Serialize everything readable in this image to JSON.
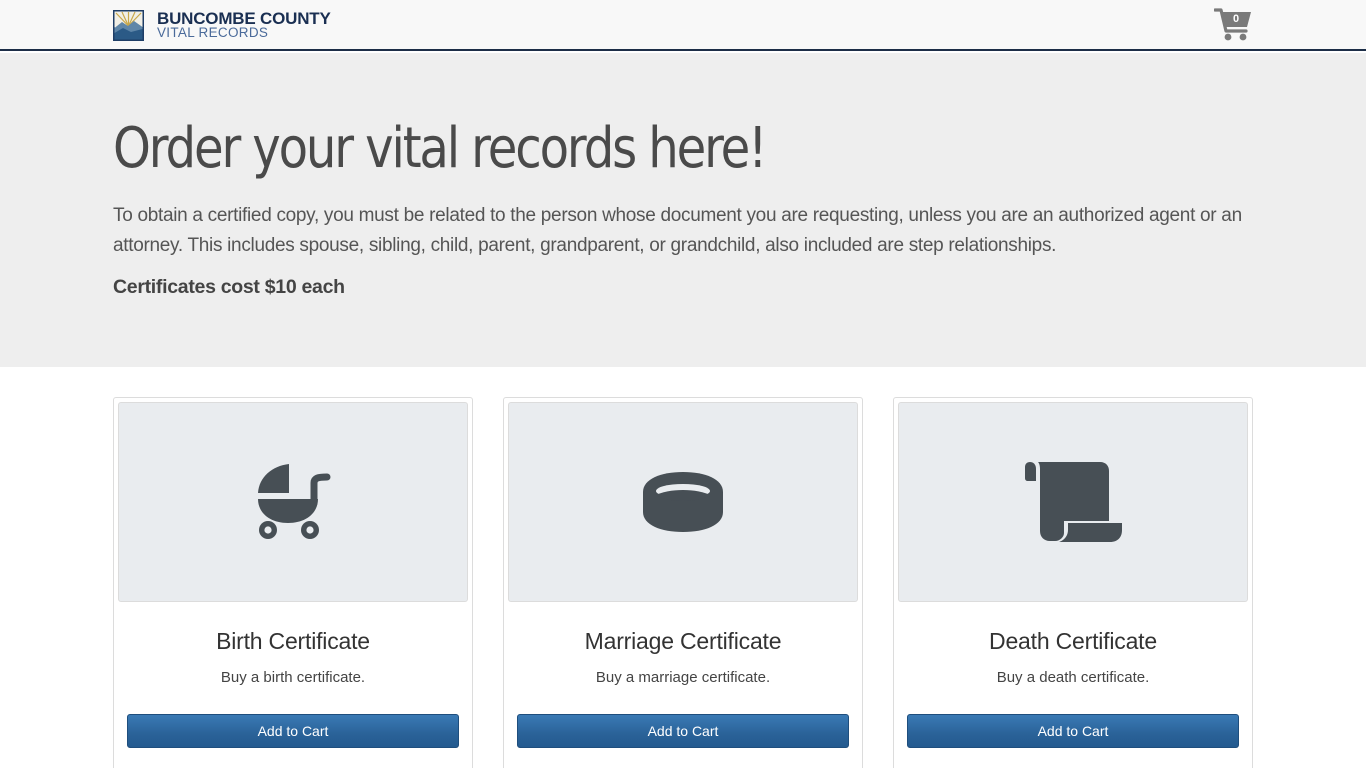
{
  "header": {
    "brand_line1": "BUNCOMBE COUNTY",
    "brand_line2": "VITAL RECORDS",
    "cart_count": "0",
    "cart_icon": "shopping-cart-icon"
  },
  "hero": {
    "title": "Order your vital records here!",
    "description": "To obtain a certified copy, you must be related to the person whose document you are requesting, unless you are an authorized agent or an attorney. This includes spouse, sibling, child, parent, grandparent, or grandchild, also included are step relationships.",
    "price_note": "Certificates cost $10 each"
  },
  "cards": [
    {
      "icon": "baby-carriage-icon",
      "title": "Birth Certificate",
      "description": "Buy a birth certificate.",
      "button": "Add to Cart"
    },
    {
      "icon": "ring-icon",
      "title": "Marriage Certificate",
      "description": "Buy a marriage certificate.",
      "button": "Add to Cart"
    },
    {
      "icon": "scroll-icon",
      "title": "Death Certificate",
      "description": "Buy a death certificate.",
      "button": "Add to Cart"
    }
  ],
  "colors": {
    "navy": "#1a2f52",
    "icon": "#474f55",
    "button": "#2a6298",
    "hero_bg": "#eeeeee",
    "card_image_bg": "#e9ecef"
  }
}
